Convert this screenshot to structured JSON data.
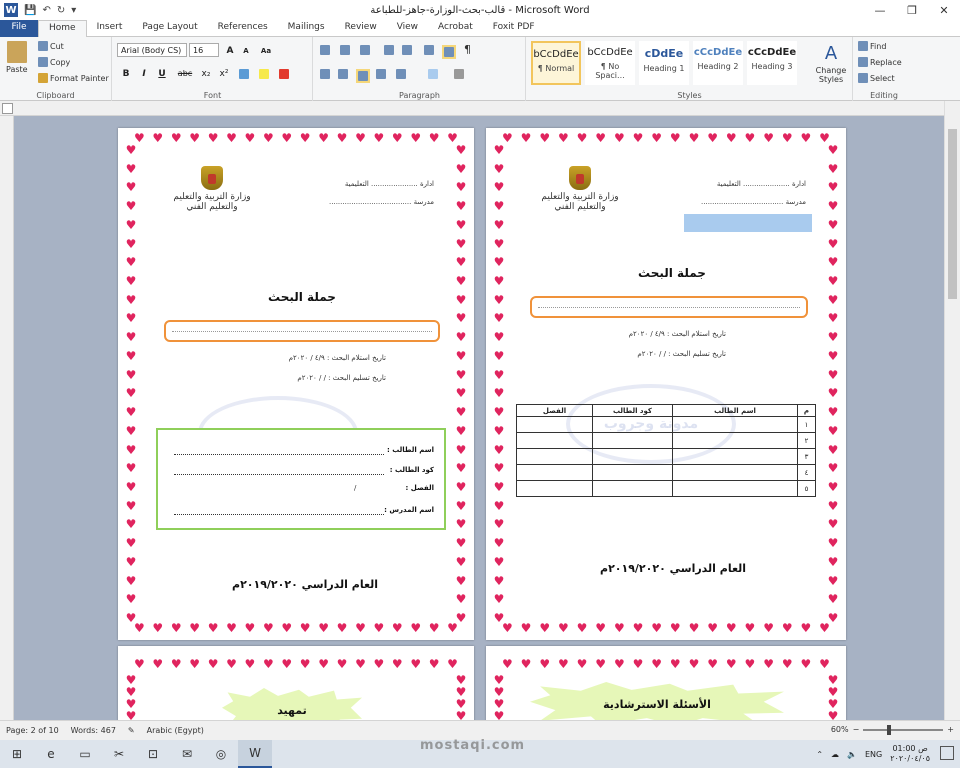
{
  "window": {
    "title": "قالب-بحث-الوزارة-جاهز-للطباعة - Microsoft Word",
    "app_icon": "W",
    "controls": {
      "minimize": "—",
      "restore": "❐",
      "close": "✕"
    }
  },
  "qat": {
    "save": "💾",
    "undo": "↶",
    "redo": "↻",
    "more": "▾"
  },
  "tabs": [
    "File",
    "Home",
    "Insert",
    "Page Layout",
    "References",
    "Mailings",
    "Review",
    "View",
    "Acrobat",
    "Foxit PDF"
  ],
  "active_tab": "Home",
  "clipboard": {
    "paste": "Paste",
    "cut": "Cut",
    "copy": "Copy",
    "format_painter": "Format Painter",
    "label": "Clipboard"
  },
  "font": {
    "name": "Arial (Body CS)",
    "size": "16",
    "label": "Font",
    "bold": "B",
    "italic": "I",
    "underline": "U",
    "strike": "abc",
    "sub": "x₂",
    "sup": "x²",
    "grow": "A",
    "shrink": "A",
    "clear": "Aa"
  },
  "paragraph": {
    "label": "Paragraph",
    "show_marks": "¶"
  },
  "styles": {
    "label": "Styles",
    "items": [
      {
        "preview": "bCcDdEe",
        "name": "¶ Normal"
      },
      {
        "preview": "bCcDdEe",
        "name": "¶ No Spaci..."
      },
      {
        "preview": "cDdEe",
        "name": "Heading 1"
      },
      {
        "preview": "cCcDdEe",
        "name": "Heading 2"
      },
      {
        "preview": "cCcDdEe",
        "name": "Heading 3"
      }
    ],
    "change": "Change Styles"
  },
  "editing": {
    "label": "Editing",
    "find": "Find",
    "replace": "Replace",
    "select": "Select"
  },
  "doc": {
    "idara": "ادارة ..................... التعليمية",
    "madrasa": "مدرسة .....................................",
    "ministry": "وزارة التربية والتعليم والتعليم الفني",
    "title": "جملة البحث",
    "date_received": "تاريخ استلام البحث  : ٤/٩ / ٢٠٢٠م",
    "date_submit": "تاريخ تسليم البحث :   /    / ٢٠٢٠م",
    "year": "العام الدراسي ٢٠١٩/٢٠٢٠م",
    "student_name": "اسم الطالب :",
    "student_code": "كود الطالب :",
    "class": "الفصل :",
    "class_value": "/",
    "teacher": "اسم المدرس :",
    "watermark": "مدونة وجروب",
    "table_headers": [
      "م",
      "اسم الطالب",
      "كود الطالب",
      "الفصل"
    ],
    "table_rows": [
      "١",
      "٢",
      "٣",
      "٤",
      "٥"
    ],
    "intro": "تمهيد",
    "guide_q": "الأسئلة الاسترشادية"
  },
  "status": {
    "page": "Page: 2 of 10",
    "words": "Words: 467",
    "lang": "Arabic (Egypt)",
    "zoom": "60%",
    "zoom_level": 0.6
  },
  "taskbar": {
    "lang": "ENG",
    "time": "01:00 ص",
    "date": "٢٠٢٠/٠٤/٠٥"
  },
  "watermark_site": "mostaqi.com"
}
